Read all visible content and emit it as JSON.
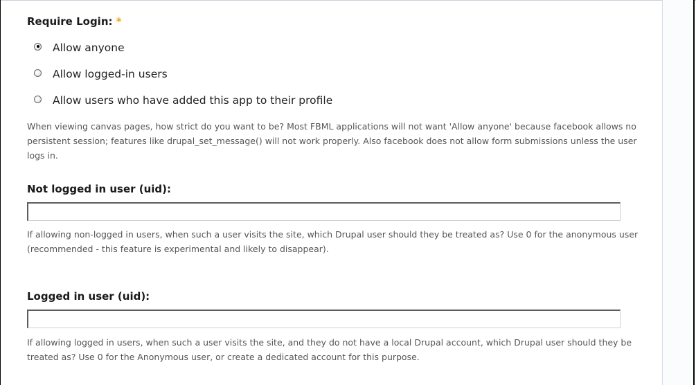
{
  "require_login": {
    "label": "Require Login:",
    "required_marker": "*",
    "options": [
      {
        "label": "Allow anyone",
        "checked": true
      },
      {
        "label": "Allow logged-in users",
        "checked": false
      },
      {
        "label": "Allow users who have added this app to their profile",
        "checked": false
      }
    ],
    "description": "When viewing canvas pages, how strict do you want to be? Most FBML applications will not want 'Allow anyone' because facebook allows no persistent session; features like drupal_set_message() will not work properly. Also facebook does not allow form submissions unless the user logs in."
  },
  "not_logged_in_uid": {
    "label": "Not logged in user (uid):",
    "value": "",
    "description": "If allowing non-logged in users, when such a user visits the site, which Drupal user should they be treated as? Use 0 for the anonymous user (recommended - this feature is experimental and likely to disappear)."
  },
  "logged_in_uid": {
    "label": "Logged in user (uid):",
    "value": "",
    "description": "If allowing logged in users, when such a user visits the site, and they do not have a local Drupal account, which Drupal user should they be treated as? Use 0 for the Anonymous user, or create a dedicated account for this purpose."
  },
  "colors": {
    "required_marker": "#f0a510",
    "description_text": "#555555"
  }
}
